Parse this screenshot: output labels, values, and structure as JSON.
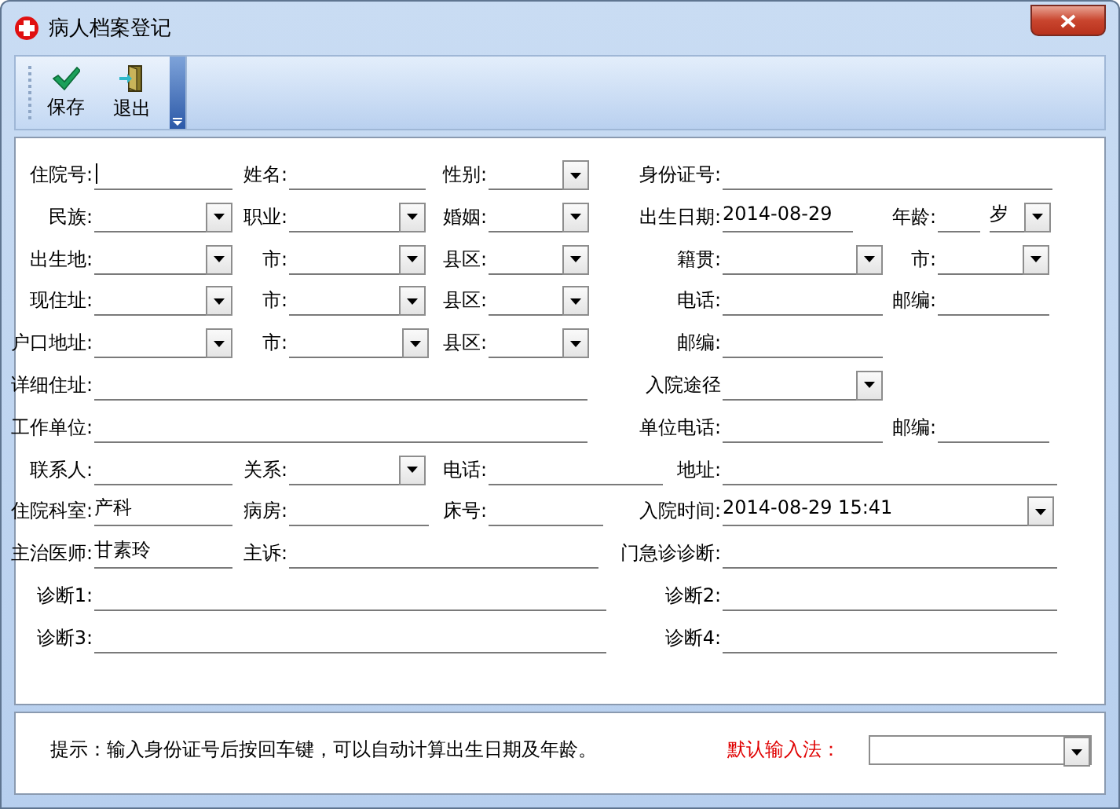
{
  "window": {
    "title": "病人档案登记"
  },
  "toolbar": [
    {
      "label": "保存",
      "kind": "save"
    },
    {
      "label": "退出",
      "kind": "exit"
    }
  ],
  "form": {
    "rows": [
      {
        "left": [
          {
            "label": "住院号:",
            "kind": "text",
            "focused": true
          },
          {
            "label": "姓名:",
            "kind": "text"
          },
          {
            "label": "性别:",
            "kind": "combo"
          }
        ],
        "right": [
          {
            "label": "身份证号:",
            "kind": "text"
          }
        ]
      },
      {
        "left": [
          {
            "label": "民族:",
            "kind": "combo"
          },
          {
            "label": "职业:",
            "kind": "combo"
          },
          {
            "label": "婚姻:",
            "kind": "combo"
          }
        ],
        "right": [
          {
            "label": "出生日期:",
            "kind": "text",
            "value": "2014-08-29"
          },
          {
            "label": "年龄:",
            "kind": "text"
          },
          {
            "kind": "combo",
            "value": "岁"
          }
        ]
      },
      {
        "left": [
          {
            "label": "出生地:",
            "kind": "combo"
          },
          {
            "label": "市:",
            "kind": "combo"
          },
          {
            "label": "县区:",
            "kind": "combo"
          }
        ],
        "right": [
          {
            "label": "籍贯:",
            "kind": "combo"
          },
          {
            "label": "市:",
            "kind": "combo"
          }
        ]
      },
      {
        "left": [
          {
            "label": "现住址:",
            "kind": "combo"
          },
          {
            "label": "市:",
            "kind": "combo"
          },
          {
            "label": "县区:",
            "kind": "combo"
          }
        ],
        "right": [
          {
            "label": "电话:",
            "kind": "text"
          },
          {
            "label": "邮编:",
            "kind": "text"
          }
        ]
      },
      {
        "left": [
          {
            "label": "户口地址:",
            "kind": "combo"
          },
          {
            "label": "市:",
            "kind": "combo"
          },
          {
            "label": "县区:",
            "kind": "combo"
          }
        ],
        "right": [
          {
            "label": "邮编:",
            "kind": "text"
          }
        ]
      },
      {
        "left": [
          {
            "label": "详细住址:",
            "kind": "text"
          }
        ],
        "right": [
          {
            "label": "入院途径",
            "kind": "combo"
          }
        ]
      },
      {
        "left": [
          {
            "label": "工作单位:",
            "kind": "text"
          }
        ],
        "right": [
          {
            "label": "单位电话:",
            "kind": "text"
          },
          {
            "label": "邮编:",
            "kind": "text"
          }
        ]
      },
      {
        "left": [
          {
            "label": "联系人:",
            "kind": "text"
          },
          {
            "label": "关系:",
            "kind": "combo"
          },
          {
            "label": "电话:",
            "kind": "text"
          }
        ],
        "right": [
          {
            "label": "地址:",
            "kind": "text"
          }
        ]
      },
      {
        "left": [
          {
            "label": "住院科室:",
            "kind": "text",
            "value": "产科"
          },
          {
            "label": "病房:",
            "kind": "text"
          },
          {
            "label": "床号:",
            "kind": "text"
          }
        ],
        "right": [
          {
            "label": "入院时间:",
            "kind": "combo",
            "value": "2014-08-29 15:41"
          }
        ]
      },
      {
        "left": [
          {
            "label": "主治医师:",
            "kind": "text",
            "value": "甘素玲"
          },
          {
            "label": "主诉:",
            "kind": "text"
          }
        ],
        "right": [
          {
            "label": "门急诊诊断:",
            "kind": "text"
          }
        ]
      },
      {
        "left": [
          {
            "label": "诊断1:",
            "kind": "text"
          }
        ],
        "right": [
          {
            "label": "诊断2:",
            "kind": "text"
          }
        ]
      },
      {
        "left": [
          {
            "label": "诊断3:",
            "kind": "text"
          }
        ],
        "right": [
          {
            "label": "诊断4:",
            "kind": "text"
          }
        ]
      }
    ]
  },
  "hint": "提示：输入身份证号后按回车键，可以自动计算出生日期及年龄。",
  "input_method": {
    "label": "默认输入法：",
    "kind": "combo"
  }
}
